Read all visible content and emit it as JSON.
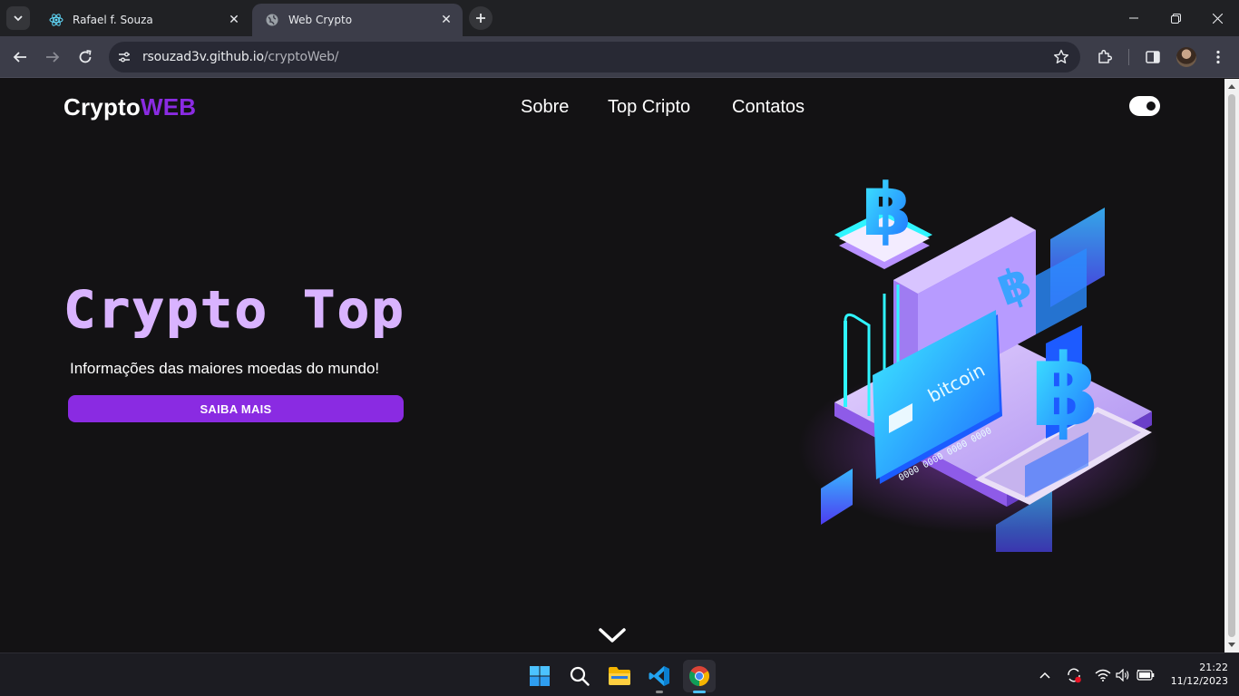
{
  "browser": {
    "tabs": [
      {
        "title": "Rafael f. Souza",
        "icon": "react-icon",
        "active": false
      },
      {
        "title": "Web Crypto",
        "icon": "globe-icon",
        "active": true
      }
    ],
    "url_host": "rsouzad3v.github.io",
    "url_path": "/cryptoWeb/"
  },
  "site": {
    "logo_main": "Crypto",
    "logo_accent": "WEB",
    "nav": [
      "Sobre",
      "Top Cripto",
      "Contatos"
    ],
    "theme_toggle_on": true
  },
  "hero": {
    "title": "Crypto Top",
    "subtitle": "Informações das maiores moedas do mundo!",
    "cta": "SAIBA MAIS",
    "card_brand": "bitcoin",
    "card_number": "0000 0000 0000 0000"
  },
  "taskbar": {
    "apps": [
      "windows-start-icon",
      "search-icon",
      "file-explorer-icon",
      "vscode-icon",
      "chrome-icon"
    ],
    "time": "21:22",
    "date": "11/12/2023"
  },
  "colors": {
    "accent": "#8a2be2",
    "background": "#131214",
    "title_lavender": "#d9b3ff"
  }
}
